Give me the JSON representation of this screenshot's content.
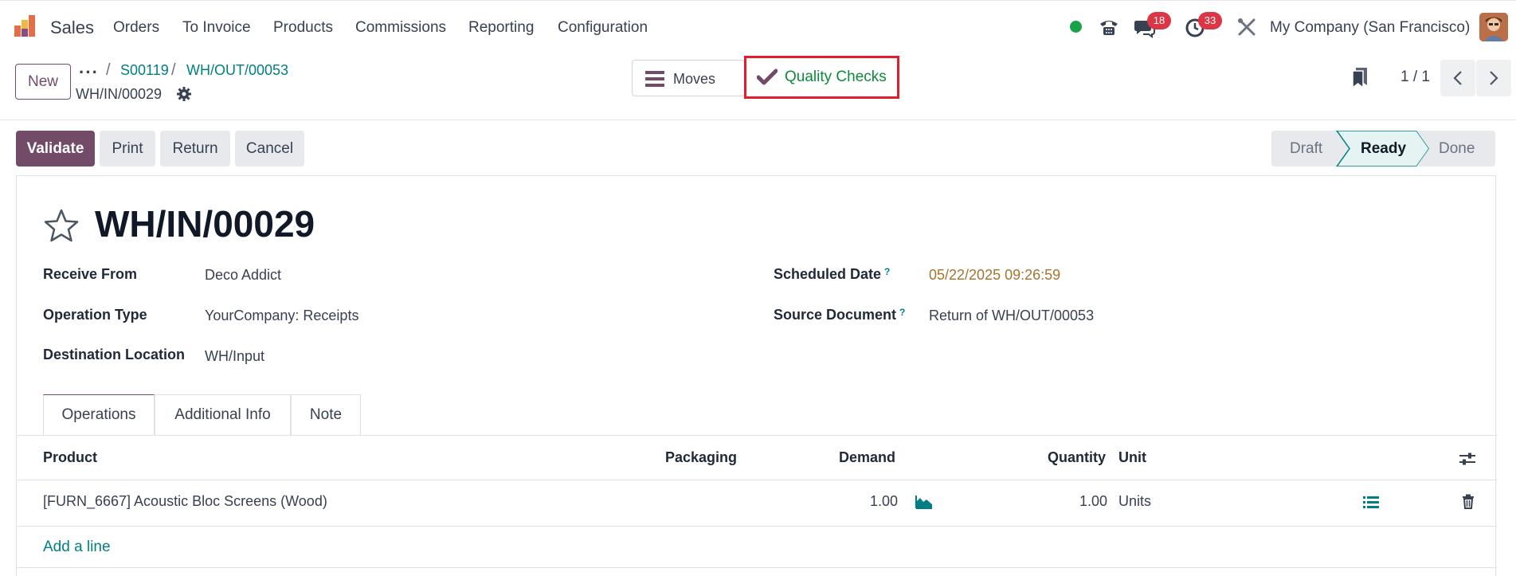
{
  "navbar": {
    "app_name": "Sales",
    "menu": [
      "Orders",
      "To Invoice",
      "Products",
      "Commissions",
      "Reporting",
      "Configuration"
    ],
    "messages_count": "18",
    "activities_count": "33",
    "company": "My Company (San Francisco)"
  },
  "control": {
    "new_label": "New",
    "breadcrumb": [
      "S00119",
      "WH/OUT/00053"
    ],
    "record_name": "WH/IN/00029",
    "moves_label": "Moves",
    "quality_checks_label": "Quality Checks",
    "pager": "1 / 1"
  },
  "statusbar": {
    "validate_label": "Validate",
    "print_label": "Print",
    "return_label": "Return",
    "cancel_label": "Cancel",
    "stages": [
      "Draft",
      "Ready",
      "Done"
    ],
    "active_stage": "Ready"
  },
  "form": {
    "title": "WH/IN/00029",
    "fields": {
      "receive_from": {
        "label": "Receive From",
        "value": "Deco Addict"
      },
      "operation_type": {
        "label": "Operation Type",
        "value": "YourCompany: Receipts"
      },
      "destination_location": {
        "label": "Destination Location",
        "value": "WH/Input"
      },
      "scheduled_date": {
        "label": "Scheduled Date",
        "value": "05/22/2025 09:26:59"
      },
      "source_document": {
        "label": "Source Document",
        "value": "Return of WH/OUT/00053"
      }
    },
    "help_marker": "?",
    "tabs": [
      "Operations",
      "Additional Info",
      "Note"
    ],
    "table": {
      "headers": [
        "Product",
        "Packaging",
        "Demand",
        "Quantity",
        "Unit"
      ],
      "rows": [
        {
          "product": "[FURN_6667] Acoustic Bloc Screens (Wood)",
          "packaging": "",
          "demand": "1.00",
          "quantity": "1.00",
          "unit": "Units"
        }
      ],
      "add_line_label": "Add a line"
    }
  },
  "colors": {
    "brand": "#714b67",
    "link": "#017e84",
    "highlight_box": "#e11d2e",
    "quality_green": "#0f8a3a",
    "date_orange": "#a7742e"
  }
}
